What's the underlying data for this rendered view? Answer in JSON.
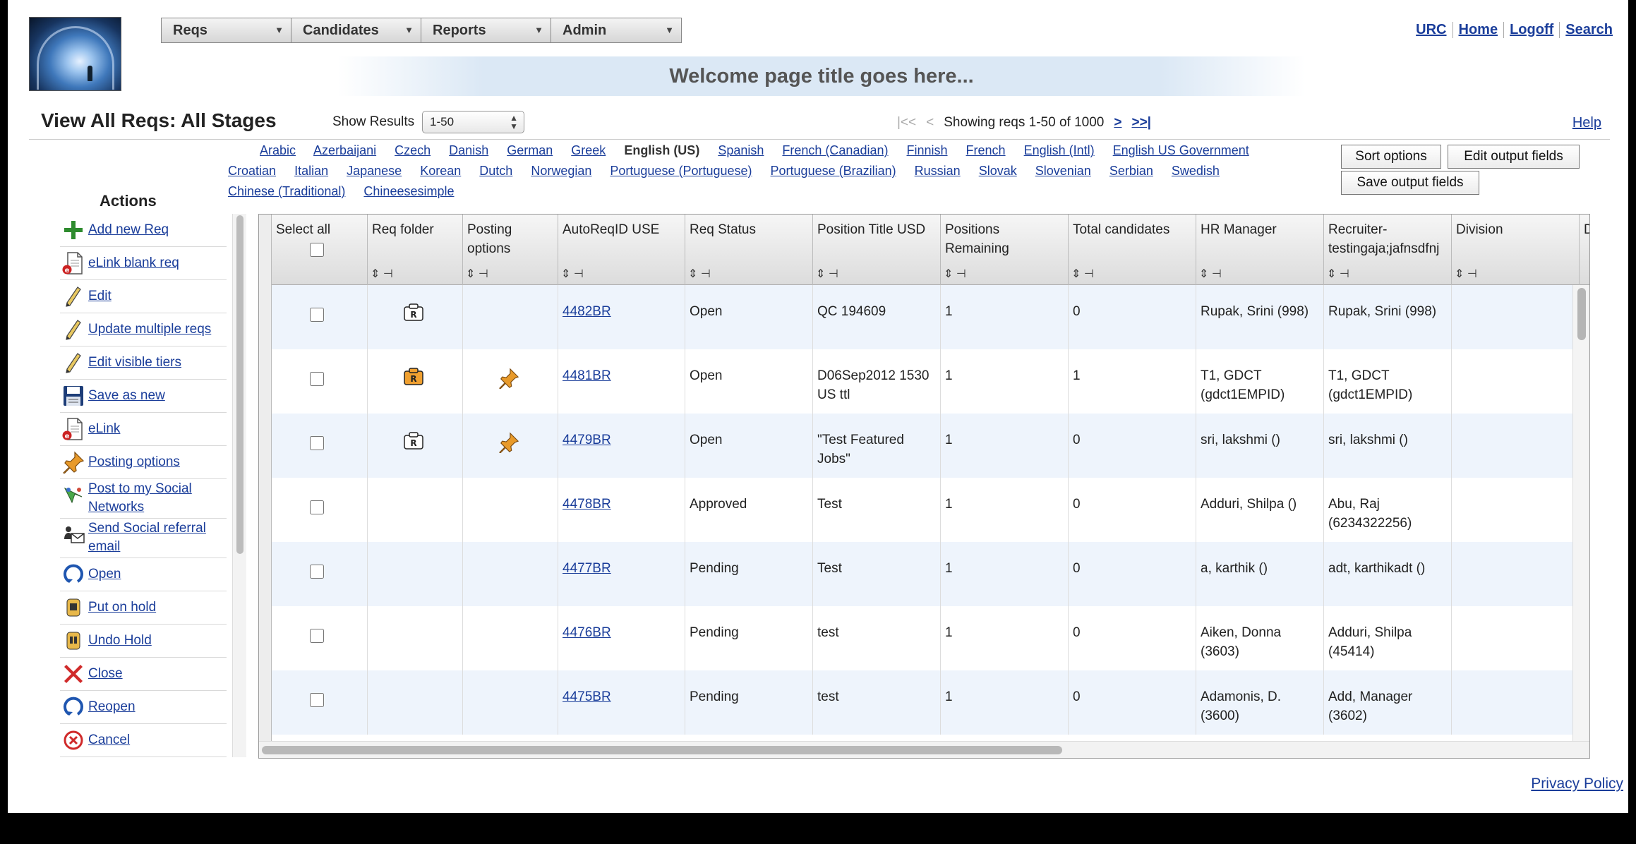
{
  "nav": {
    "menus": [
      "Reqs",
      "Candidates",
      "Reports",
      "Admin"
    ]
  },
  "top_links": [
    "URC",
    "Home",
    "Logoff",
    "Search"
  ],
  "banner": "Welcome page title goes here...",
  "page_title": "View All Reqs: All Stages",
  "show_results": {
    "label": "Show Results",
    "value": "1-50"
  },
  "pager": {
    "first": "|<<",
    "prev": "<",
    "status": "Showing reqs 1-50 of 1000",
    "next": ">",
    "last": ">>|"
  },
  "help": "Help",
  "languages": [
    {
      "label": "Arabic"
    },
    {
      "label": "Azerbaijani"
    },
    {
      "label": "Czech"
    },
    {
      "label": "Danish"
    },
    {
      "label": "German"
    },
    {
      "label": "Greek"
    },
    {
      "label": "English (US)",
      "selected": true
    },
    {
      "label": "Spanish"
    },
    {
      "label": "French (Canadian)"
    },
    {
      "label": "Finnish"
    },
    {
      "label": "French"
    },
    {
      "label": "English (Intl)"
    },
    {
      "label": "English US Government"
    },
    {
      "label": "Croatian"
    },
    {
      "label": "Italian"
    },
    {
      "label": "Japanese"
    },
    {
      "label": "Korean"
    },
    {
      "label": "Dutch"
    },
    {
      "label": "Norwegian"
    },
    {
      "label": "Portuguese (Portuguese)"
    },
    {
      "label": "Portuguese (Brazilian)"
    },
    {
      "label": "Russian"
    },
    {
      "label": "Slovak"
    },
    {
      "label": "Slovenian"
    },
    {
      "label": "Serbian"
    },
    {
      "label": "Swedish"
    },
    {
      "label": "Chinese (Traditional)"
    },
    {
      "label": "Chineesesimple"
    }
  ],
  "buttons": {
    "sort_options": "Sort options",
    "edit_output_fields": "Edit output fields",
    "save_output_fields": "Save output fields"
  },
  "actions": {
    "title": "Actions",
    "items": [
      {
        "label": "Add new Req",
        "icon": "plus-icon"
      },
      {
        "label": "eLink blank req",
        "icon": "elink-doc-icon"
      },
      {
        "label": "Edit",
        "icon": "pencil-icon"
      },
      {
        "label": "Update multiple reqs",
        "icon": "pencil-icon"
      },
      {
        "label": "Edit visible tiers",
        "icon": "pencil-icon"
      },
      {
        "label": "Save as new",
        "icon": "floppy-disk-icon"
      },
      {
        "label": "eLink",
        "icon": "elink-doc-icon"
      },
      {
        "label": "Posting options",
        "icon": "pushpin-icon"
      },
      {
        "label": "Post to my Social Networks",
        "icon": "social-network-icon"
      },
      {
        "label": "Send Social referral email",
        "icon": "referral-email-icon"
      },
      {
        "label": "Open",
        "icon": "open-circle-icon"
      },
      {
        "label": "Put on hold",
        "icon": "hold-icon"
      },
      {
        "label": "Undo Hold",
        "icon": "undo-hold-icon"
      },
      {
        "label": "Close",
        "icon": "close-x-icon"
      },
      {
        "label": "Reopen",
        "icon": "reopen-circle-icon"
      },
      {
        "label": "Cancel",
        "icon": "cancel-icon"
      }
    ]
  },
  "table": {
    "columns": [
      "Select all",
      "Req folder",
      "Posting options",
      "AutoReqID USE",
      "Req Status",
      "Position Title USD",
      "Positions Remaining",
      "Total candidates",
      "HR Manager",
      "Recruiter-testingaja;jafnsdfnj",
      "Division",
      "D"
    ],
    "rows": [
      {
        "folder": "R",
        "folder_color": "#ffffff",
        "posting": false,
        "id": "4482BR",
        "status": "Open",
        "title": "QC 194609",
        "remaining": "1",
        "candidates": "0",
        "hr": "Rupak, Srini (998)",
        "recruiter": "Rupak, Srini (998)",
        "division": ""
      },
      {
        "folder": "R",
        "folder_color": "#f0a030",
        "posting": true,
        "id": "4481BR",
        "status": "Open",
        "title": "D06Sep2012 1530 US ttl",
        "remaining": "1",
        "candidates": "1",
        "hr": "T1, GDCT (gdct1EMPID)",
        "recruiter": "T1, GDCT (gdct1EMPID)",
        "division": ""
      },
      {
        "folder": "R",
        "folder_color": "#ffffff",
        "posting": true,
        "id": "4479BR",
        "status": "Open",
        "title": "\"Test Featured Jobs\"",
        "remaining": "1",
        "candidates": "0",
        "hr": "sri, lakshmi ()",
        "recruiter": "sri, lakshmi ()",
        "division": ""
      },
      {
        "folder": "",
        "folder_color": "",
        "posting": false,
        "id": "4478BR",
        "status": "Approved",
        "title": "Test",
        "remaining": "1",
        "candidates": "0",
        "hr": "Adduri, Shilpa ()",
        "recruiter": "Abu, Raj (6234322256)",
        "division": ""
      },
      {
        "folder": "",
        "folder_color": "",
        "posting": false,
        "id": "4477BR",
        "status": "Pending",
        "title": "Test",
        "remaining": "1",
        "candidates": "0",
        "hr": "a, karthik ()",
        "recruiter": "adt, karthikadt ()",
        "division": ""
      },
      {
        "folder": "",
        "folder_color": "",
        "posting": false,
        "id": "4476BR",
        "status": "Pending",
        "title": "test",
        "remaining": "1",
        "candidates": "0",
        "hr": "Aiken, Donna (3603)",
        "recruiter": "Adduri, Shilpa (45414)",
        "division": ""
      },
      {
        "folder": "",
        "folder_color": "",
        "posting": false,
        "id": "4475BR",
        "status": "Pending",
        "title": "test",
        "remaining": "1",
        "candidates": "0",
        "hr": "Adamonis, D. (3600)",
        "recruiter": "Add, Manager (3602)",
        "division": ""
      }
    ]
  },
  "footer": {
    "privacy": "Privacy Policy"
  }
}
